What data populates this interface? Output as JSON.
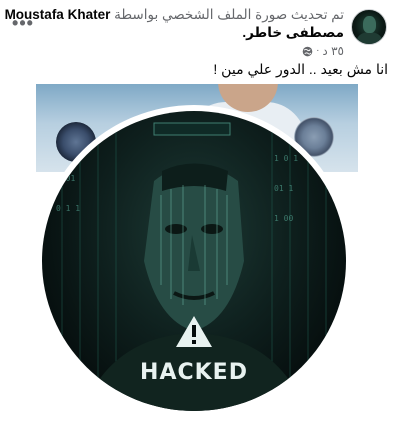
{
  "post": {
    "author_name": "Moustafa Khater",
    "action_text": "تم تحديث صورة الملف الشخصي بواسطة",
    "author_name_ar": "مصطفى خاطر.",
    "timestamp": "٣٥ د",
    "privacy": "globe-icon",
    "body_text": "انا مش بعيد .. الدور علي مين !",
    "more_label": "•••"
  },
  "photo": {
    "overlay_label": "HACKED"
  }
}
